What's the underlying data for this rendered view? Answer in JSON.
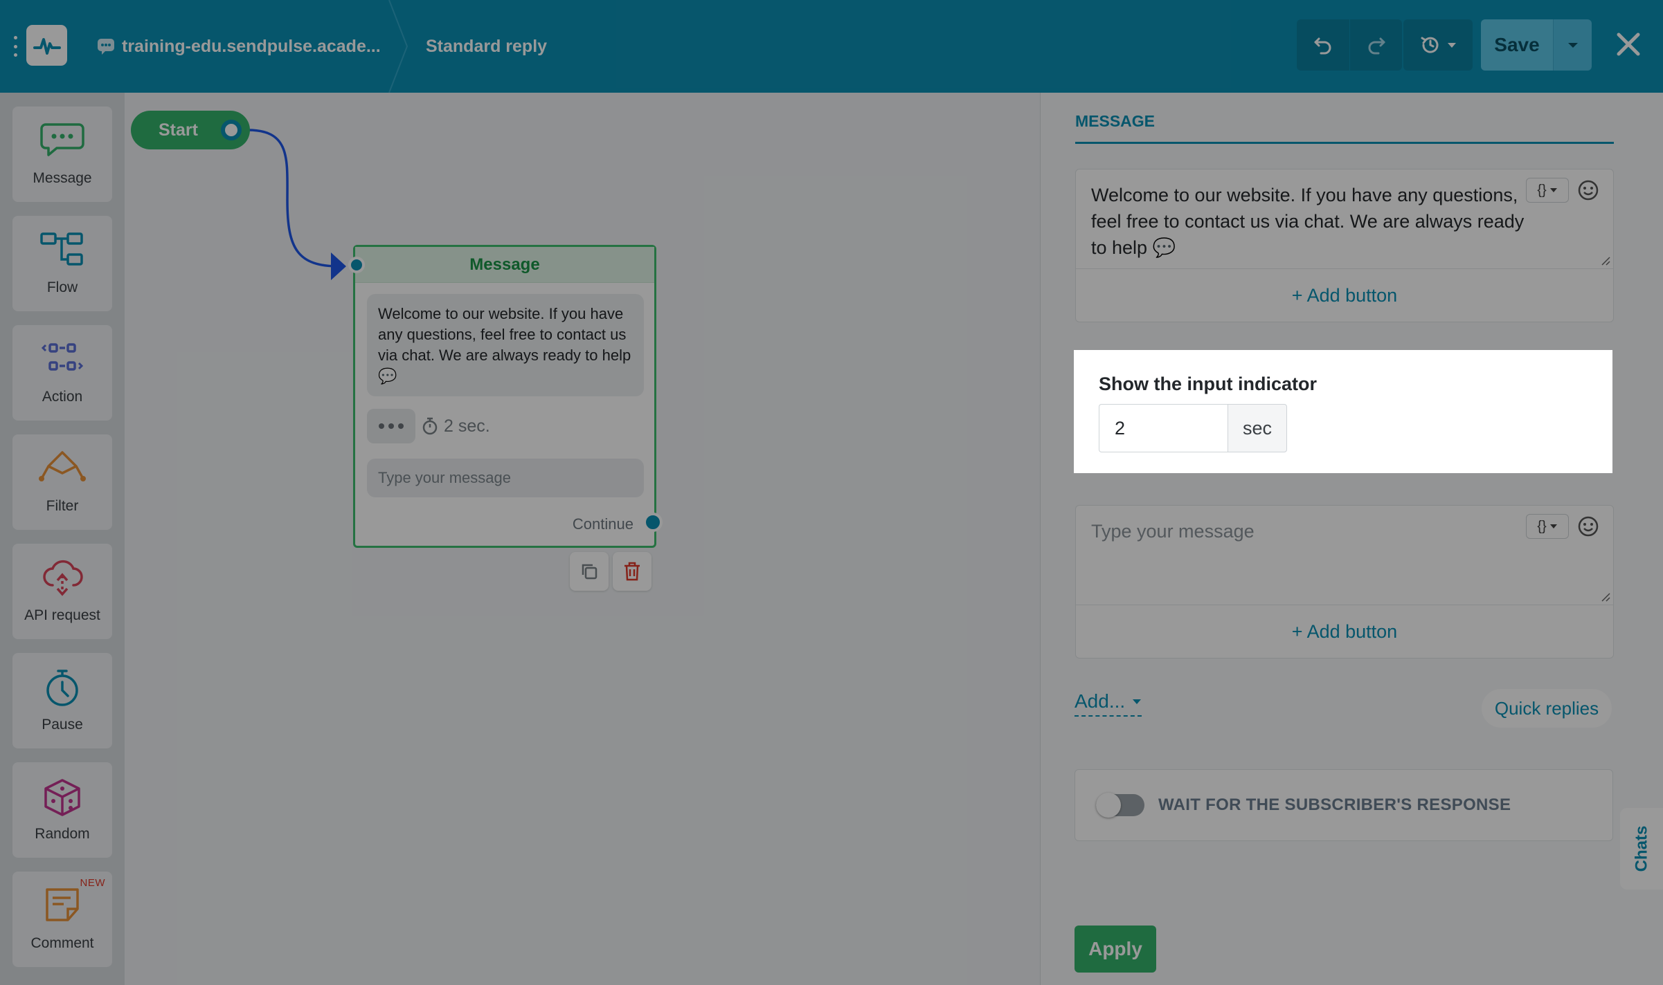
{
  "header": {
    "site_name": "training-edu.sendpulse.acade...",
    "flow_name": "Standard reply",
    "save_label": "Save",
    "icons": [
      "menu-dots-icon",
      "logo-pulse-icon",
      "chat-icon",
      "undo-icon",
      "redo-icon",
      "history-icon",
      "caret-down-icon",
      "close-icon"
    ]
  },
  "sidebar": {
    "items": [
      {
        "label": "Message",
        "icon": "message-icon",
        "color": "#34b36b"
      },
      {
        "label": "Flow",
        "icon": "flow-icon",
        "color": "#0b8fb4"
      },
      {
        "label": "Action",
        "icon": "action-icon",
        "color": "#5a6fd6"
      },
      {
        "label": "Filter",
        "icon": "filter-icon",
        "color": "#e8923a"
      },
      {
        "label": "API request",
        "icon": "api-request-icon",
        "color": "#d9455b"
      },
      {
        "label": "Pause",
        "icon": "pause-clock-icon",
        "color": "#0b8fb4"
      },
      {
        "label": "Random",
        "icon": "random-dice-icon",
        "color": "#c2348f"
      },
      {
        "label": "Comment",
        "icon": "comment-icon",
        "color": "#e8923a",
        "badge": "NEW"
      }
    ]
  },
  "canvas": {
    "start_label": "Start",
    "node": {
      "title": "Message",
      "text": "Welcome to our website. If you have any questions, feel free to contact us via chat. We are always ready to help 💬",
      "delay": "2 sec.",
      "input_placeholder": "Type your message",
      "continue_label": "Continue"
    }
  },
  "panel": {
    "tab": "MESSAGE",
    "message1": "Welcome to our website. If you have any questions, feel free to contact us via chat. We are always ready to help 💬",
    "add_button": "+ Add button",
    "indicator_title": "Show the input indicator",
    "indicator_value": "2",
    "indicator_unit": "sec",
    "message2_placeholder": "Type your message",
    "add_menu": "Add...",
    "quick_replies": "Quick replies",
    "wait_label": "WAIT FOR THE SUBSCRIBER'S RESPONSE",
    "wait_enabled": false,
    "apply": "Apply",
    "chats": "Chats",
    "var_button": "{}"
  },
  "colors": {
    "brand": "#0b8fb4",
    "success": "#34b36b"
  }
}
